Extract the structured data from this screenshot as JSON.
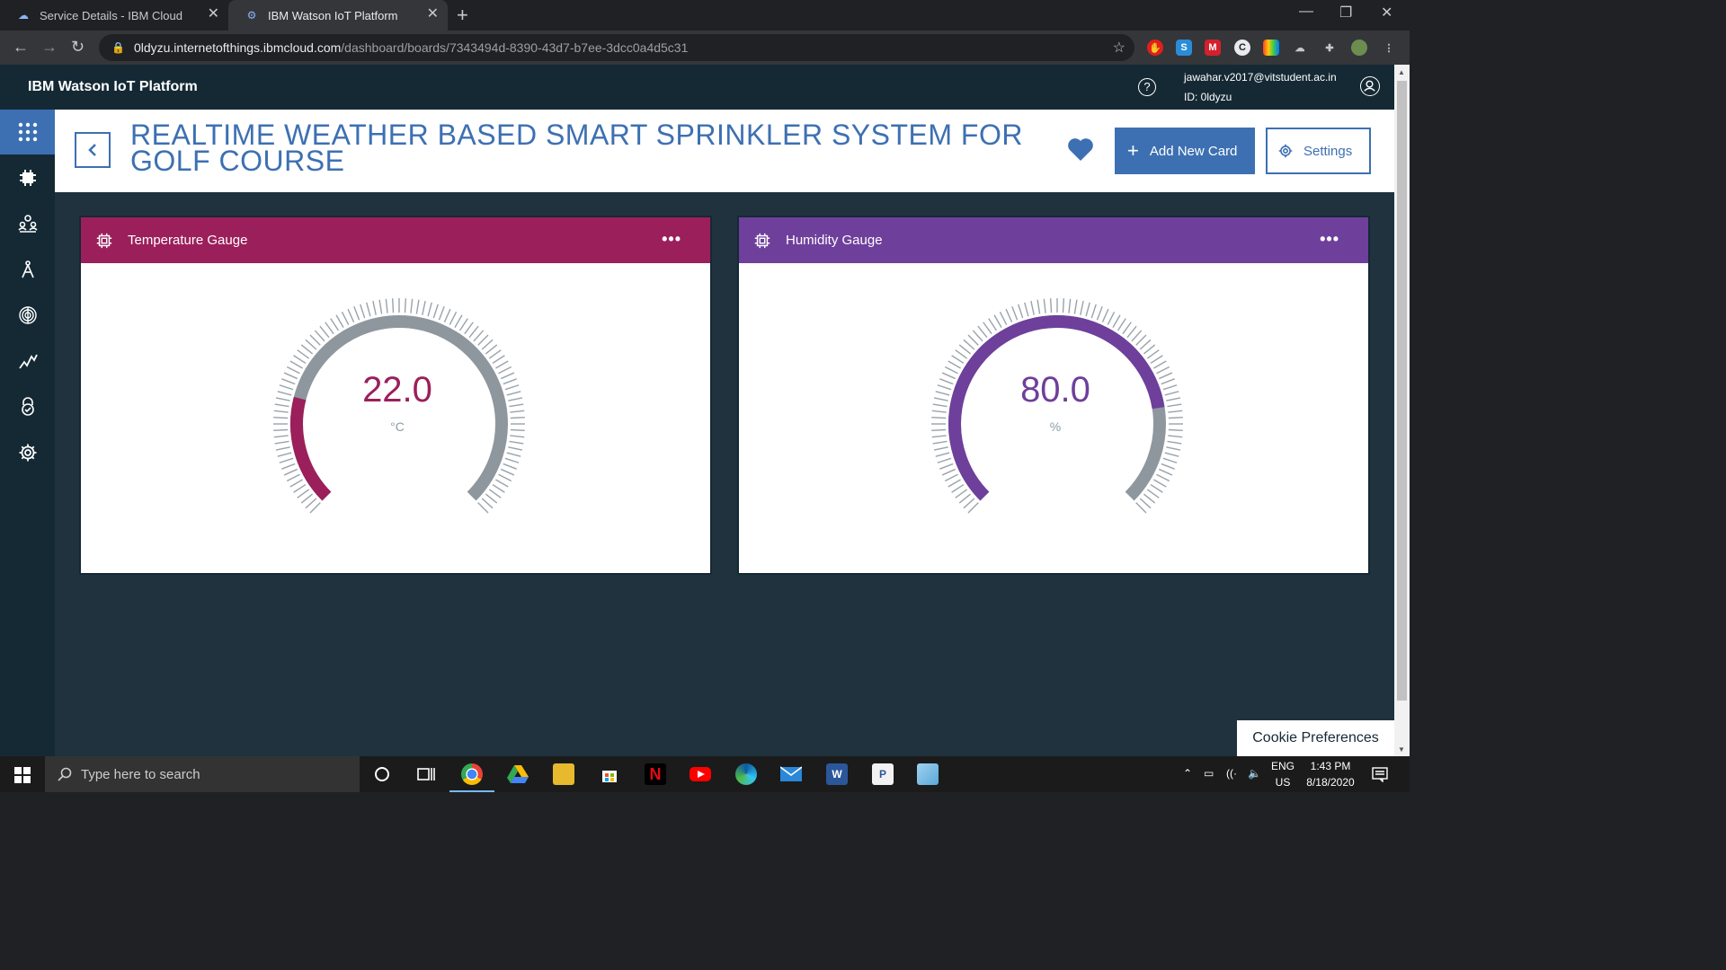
{
  "browser": {
    "tabs": [
      {
        "title": "Service Details - IBM Cloud",
        "active": false,
        "favicon": "ibm-cloud-icon"
      },
      {
        "title": "IBM Watson IoT Platform",
        "active": true,
        "favicon": "watson-iot-icon"
      }
    ],
    "url_host": "0ldyzu.internetofthings.ibmcloud.com",
    "url_path": "/dashboard/boards/7343494d-8390-43d7-b7ee-3dcc0a4d5c31"
  },
  "app": {
    "title": "IBM Watson IoT Platform",
    "user_email": "jawahar.v2017@vitstudent.ac.in",
    "org_id": "ID: 0ldyzu",
    "accent": "#3d70b2",
    "header_bg": "#152935"
  },
  "sidebar": {
    "items": [
      {
        "icon": "apps-grid-icon",
        "active": true
      },
      {
        "icon": "devices-chip-icon",
        "active": false
      },
      {
        "icon": "members-icon",
        "active": false
      },
      {
        "icon": "apps-compass-icon",
        "active": false
      },
      {
        "icon": "fingerprint-icon",
        "active": false
      },
      {
        "icon": "analytics-icon",
        "active": false
      },
      {
        "icon": "security-lock-icon",
        "active": false
      },
      {
        "icon": "settings-gear-icon",
        "active": false
      }
    ]
  },
  "board": {
    "title": "REALTIME WEATHER BASED SMART SPRINKLER SYSTEM FOR GOLF COURSE",
    "add_card_label": "Add New Card",
    "settings_label": "Settings",
    "favorite": true
  },
  "cards": [
    {
      "title": "Temperature Gauge",
      "value": "22.0",
      "unit": "°C",
      "fraction": 0.22,
      "color": "#9b1f5b",
      "track_color": "#8f979e"
    },
    {
      "title": "Humidity Gauge",
      "value": "80.0",
      "unit": "%",
      "fraction": 0.8,
      "color": "#6e3f9b",
      "track_color": "#8f979e"
    }
  ],
  "cookie_label": "Cookie Preferences",
  "taskbar": {
    "search_placeholder": "Type here to search",
    "lang": "ENG",
    "region": "US",
    "time": "1:43 PM",
    "date": "8/18/2020"
  }
}
